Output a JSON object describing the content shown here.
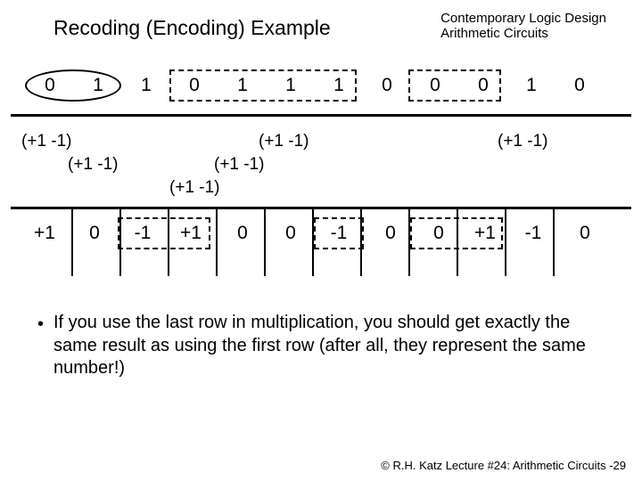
{
  "title": "Recoding (Encoding) Example",
  "header": {
    "line1": "Contemporary Logic Design",
    "line2": "Arithmetic Circuits"
  },
  "row1": [
    "0",
    "1",
    "1",
    "0",
    "1",
    "1",
    "1",
    "0",
    "0",
    "0",
    "1",
    "0"
  ],
  "pairs": {
    "p1": "(+1  -1)",
    "p2": "(+1   -1)",
    "p3": "(+1  -1)",
    "p4": "(+1   -1)",
    "p5": "(+1   -1)",
    "p6": "(+1  -1)"
  },
  "row3": [
    "+1",
    "0",
    "-1",
    "+1",
    "0",
    "0",
    "-1",
    "0",
    "0",
    "+1",
    "-1",
    "0"
  ],
  "bullet": "If you use the last row in multiplication, you should get exactly the same result as using the first row (after all, they represent the same number!)",
  "footer": "© R.H. Katz   Lecture #24: Arithmetic Circuits -29"
}
